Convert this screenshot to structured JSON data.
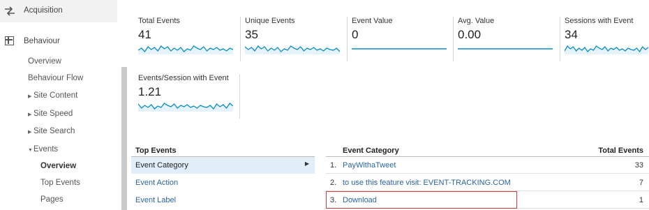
{
  "sidebar": {
    "acquisition": "Acquisition",
    "behaviour": "Behaviour",
    "items": [
      {
        "label": "Overview"
      },
      {
        "label": "Behaviour Flow"
      },
      {
        "label": "Site Content"
      },
      {
        "label": "Site Speed"
      },
      {
        "label": "Site Search"
      },
      {
        "label": "Events"
      },
      {
        "label": "Overview"
      },
      {
        "label": "Top Events"
      },
      {
        "label": "Pages"
      }
    ]
  },
  "metrics": [
    {
      "label": "Total Events",
      "value": "41"
    },
    {
      "label": "Unique Events",
      "value": "35"
    },
    {
      "label": "Event Value",
      "value": "0"
    },
    {
      "label": "Avg. Value",
      "value": "0.00"
    },
    {
      "label": "Sessions with Event",
      "value": "34"
    },
    {
      "label": "Events/Session with Event",
      "value": "1.21"
    }
  ],
  "top_events": {
    "heading": "Top Events",
    "dimensions": [
      "Event Category",
      "Event Action",
      "Event Label"
    ]
  },
  "table": {
    "col_category": "Event Category",
    "col_total": "Total Events",
    "rows": [
      {
        "num": "1.",
        "category": "PayWithaTweet",
        "total": "33"
      },
      {
        "num": "2.",
        "category": "to use this feature visit: EVENT-TRACKING.COM",
        "total": "7"
      },
      {
        "num": "3.",
        "category": "Download",
        "total": "1"
      }
    ]
  },
  "colors": {
    "sparkline": "#058dc7",
    "sparkfill": "#e6f2fa",
    "link": "#2a64a0",
    "highlight": "#d23a3a"
  }
}
